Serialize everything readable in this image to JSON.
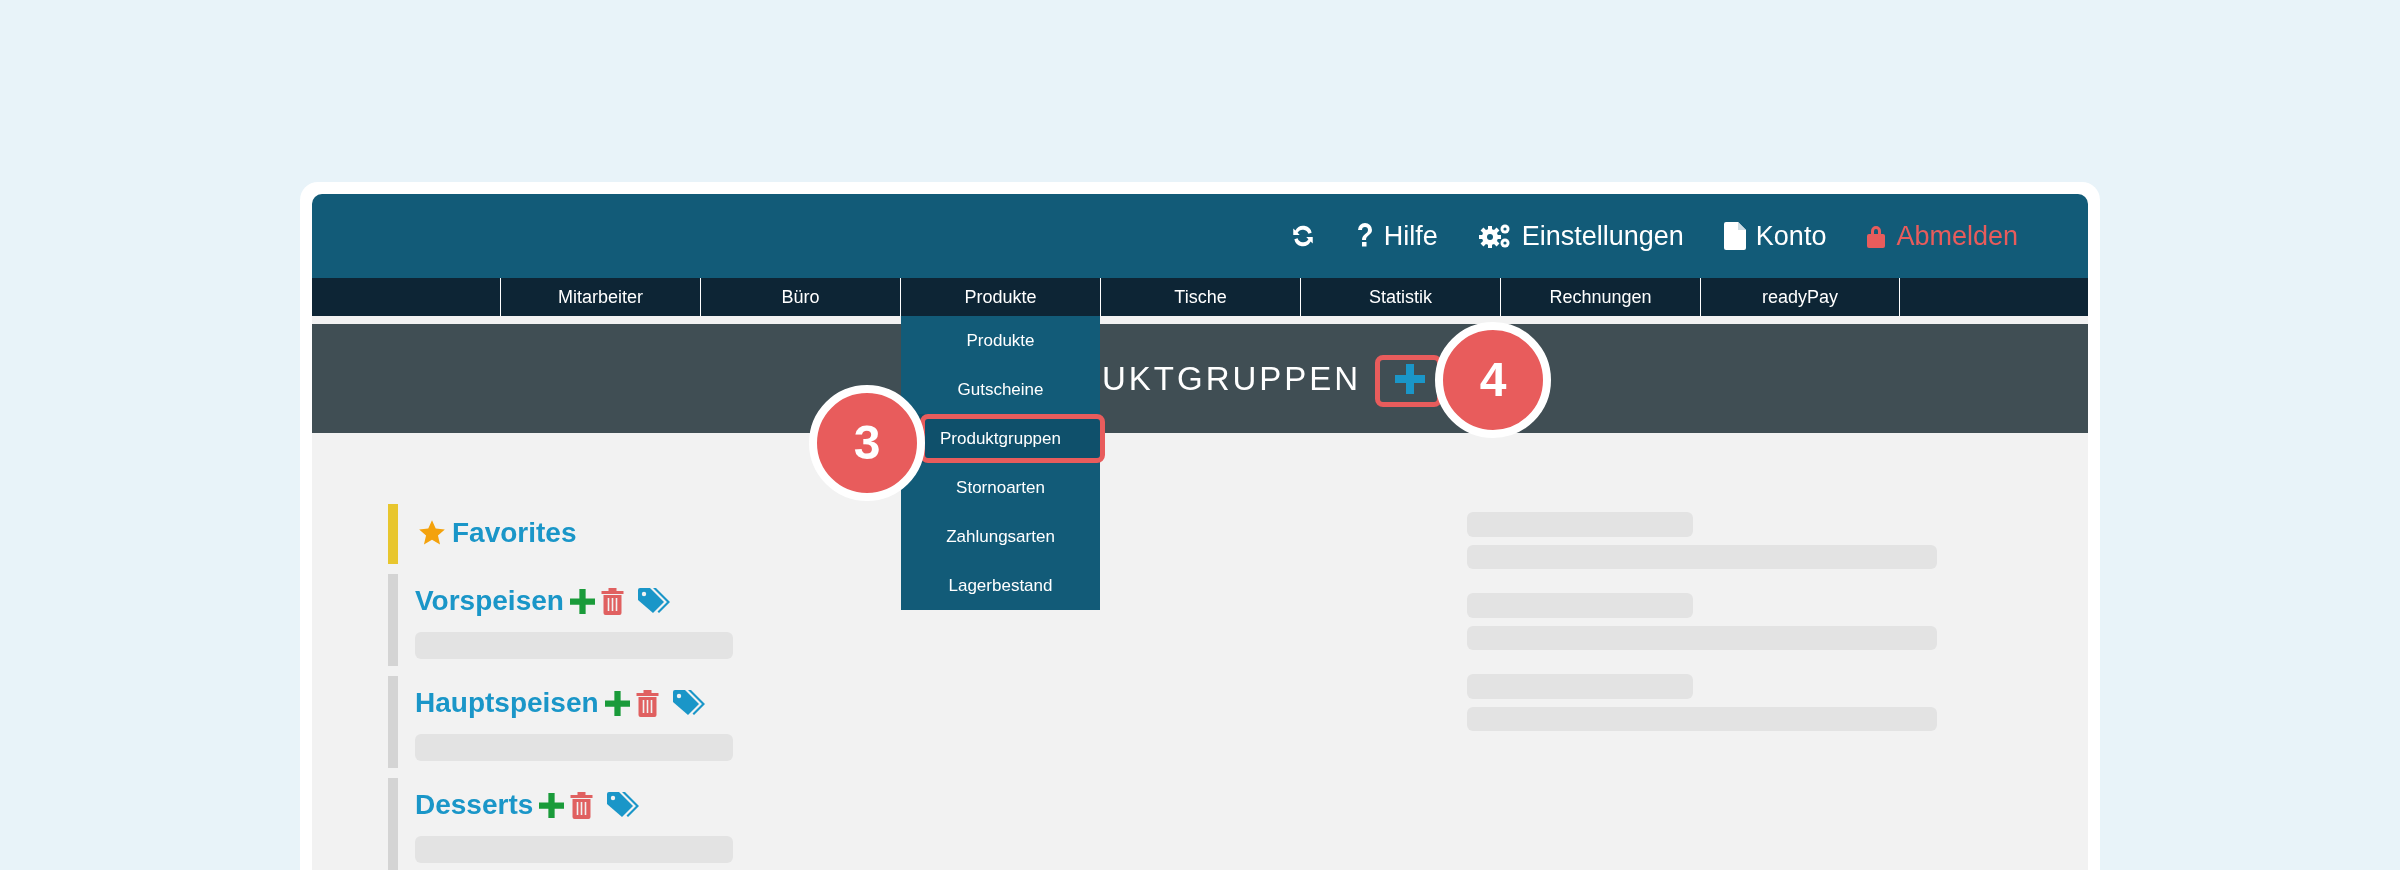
{
  "toolbar": [
    {
      "kind": "refresh"
    },
    {
      "kind": "help",
      "label": "Hilfe"
    },
    {
      "kind": "settings",
      "label": "Einstellungen"
    },
    {
      "kind": "account",
      "label": "Konto"
    },
    {
      "kind": "logout",
      "label": "Abmelden"
    }
  ],
  "nav": [
    {
      "label": "Mitarbeiter"
    },
    {
      "label": "Büro"
    },
    {
      "label": "Produkte",
      "children": [
        {
          "label": "Produkte",
          "selected": false
        },
        {
          "label": "Gutscheine",
          "selected": false
        },
        {
          "label": "Produktgruppen",
          "selected": true
        },
        {
          "label": "Stornoarten",
          "selected": false
        },
        {
          "label": "Zahlungsarten",
          "selected": false
        },
        {
          "label": "Lagerbestand",
          "selected": false
        }
      ]
    },
    {
      "label": "Tische"
    },
    {
      "label": "Statistik"
    },
    {
      "label": "Rechnungen"
    },
    {
      "label": "readyPay"
    }
  ],
  "page_title": "UKTGRUPPEN",
  "groups": [
    {
      "kind": "favorites",
      "name": "Favorites"
    },
    {
      "kind": "group",
      "name": "Vorspeisen"
    },
    {
      "kind": "group",
      "name": "Hauptspeisen"
    },
    {
      "kind": "group",
      "name": "Desserts"
    }
  ],
  "annotations": [
    "3",
    "4"
  ]
}
